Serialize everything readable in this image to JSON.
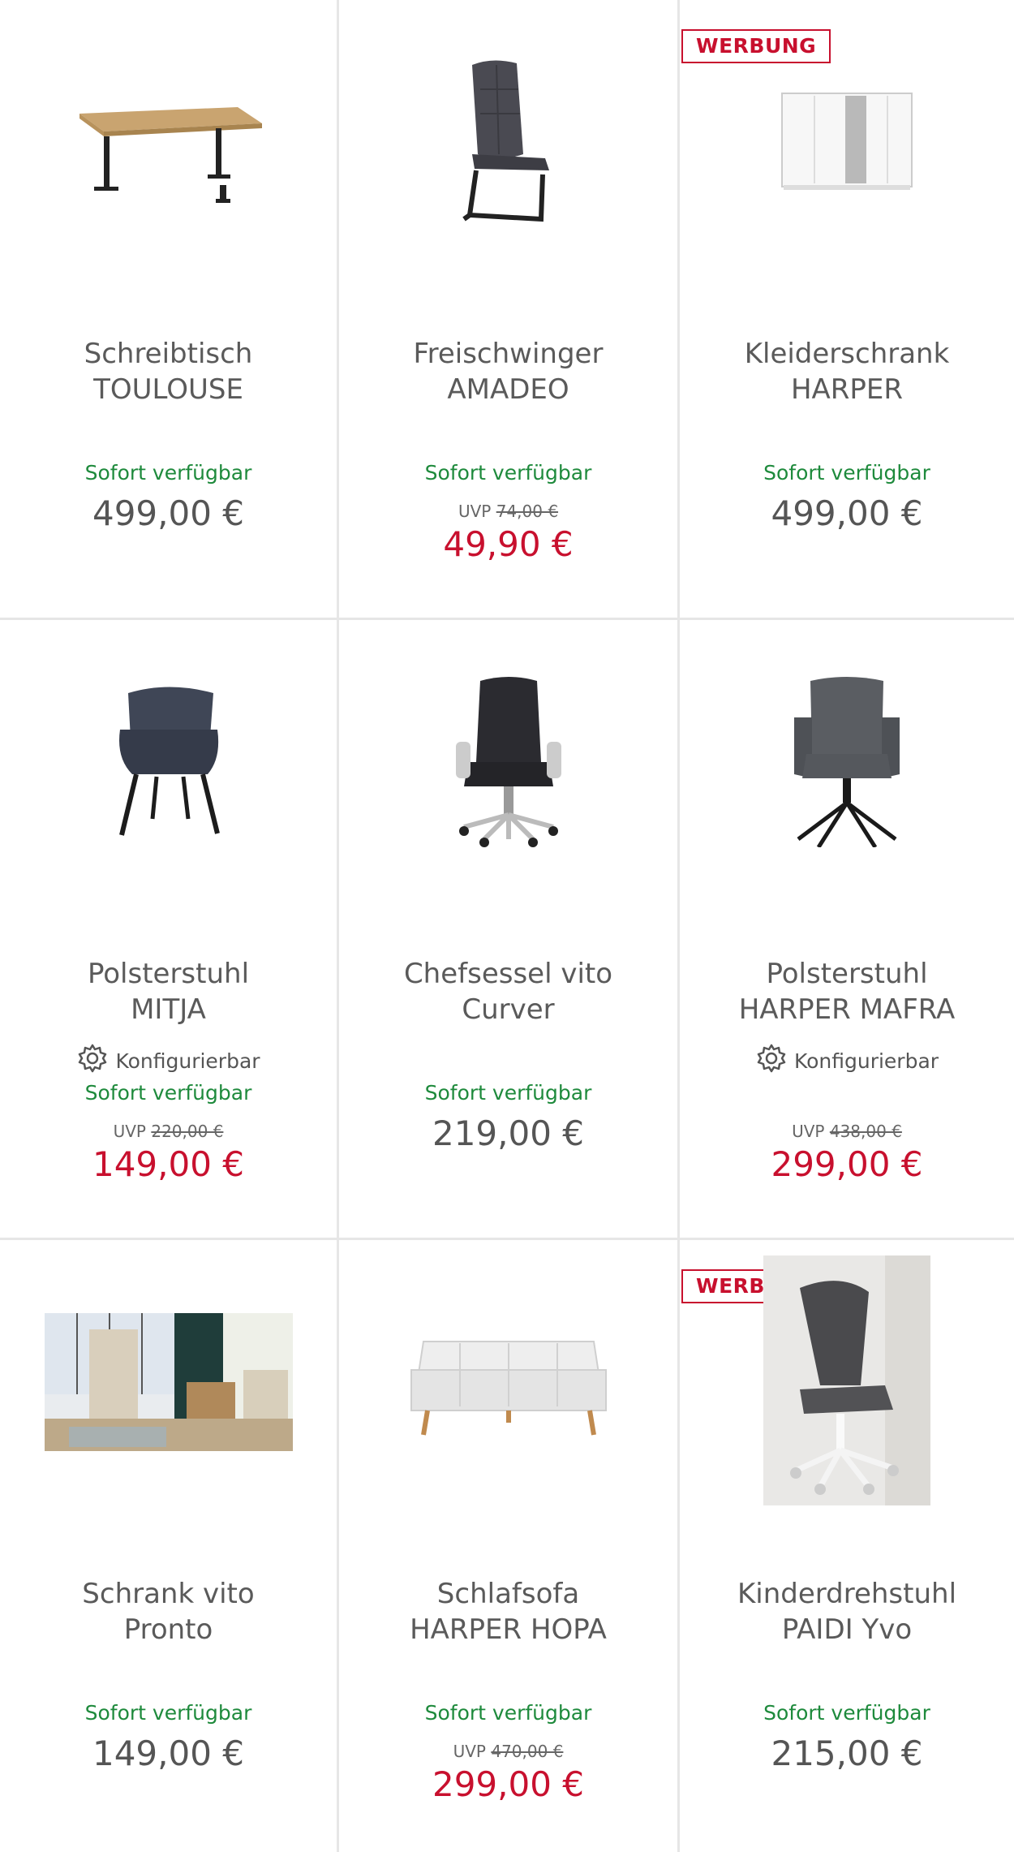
{
  "labels": {
    "ad": "WERBUNG",
    "available": "Sofort verfügbar",
    "configurable": "Konfigurierbar",
    "uvp": "UVP"
  },
  "products": [
    {
      "title1": "Schreibtisch",
      "title2": "TOULOUSE",
      "price": "499,00 €",
      "icon": "desk-image"
    },
    {
      "title1": "Freischwinger",
      "title2": "AMADEO",
      "uvp_old": "74,00 €",
      "price": "49,90 €",
      "icon": "cantilever-chair-image"
    },
    {
      "title1": "Kleiderschrank",
      "title2": "HARPER",
      "price": "499,00 €",
      "ad": true,
      "icon": "wardrobe-image"
    },
    {
      "title1": "Polsterstuhl",
      "title2": "MITJA",
      "configurable": true,
      "uvp_old": "220,00 €",
      "price": "149,00 €",
      "icon": "upholstered-chair-image"
    },
    {
      "title1": "Chefsessel vito",
      "title2": "Curver",
      "price": "219,00 €",
      "icon": "office-chair-image"
    },
    {
      "title1": "Polsterstuhl",
      "title2": "HARPER MAFRA",
      "configurable": true,
      "color_swatch": true,
      "available": false,
      "uvp_old": "438,00 €",
      "price": "299,00 €",
      "icon": "armchair-image"
    },
    {
      "title1": "Schrank vito",
      "title2": "Pronto",
      "price": "149,00 €",
      "icon": "room-cabinet-image"
    },
    {
      "title1": "Schlafsofa",
      "title2": "HARPER HOPA",
      "uvp_old": "470,00 €",
      "price": "299,00 €",
      "icon": "sofa-image"
    },
    {
      "title1": "Kinderdrehstuhl",
      "title2": "PAIDI Yvo",
      "price": "215,00 €",
      "ad": true,
      "icon": "kids-chair-image"
    }
  ],
  "colors": {
    "accent_red": "#c8102e",
    "available_green": "#1e8a3c",
    "text_gray": "#555555",
    "divider": "#e6e6e6"
  }
}
